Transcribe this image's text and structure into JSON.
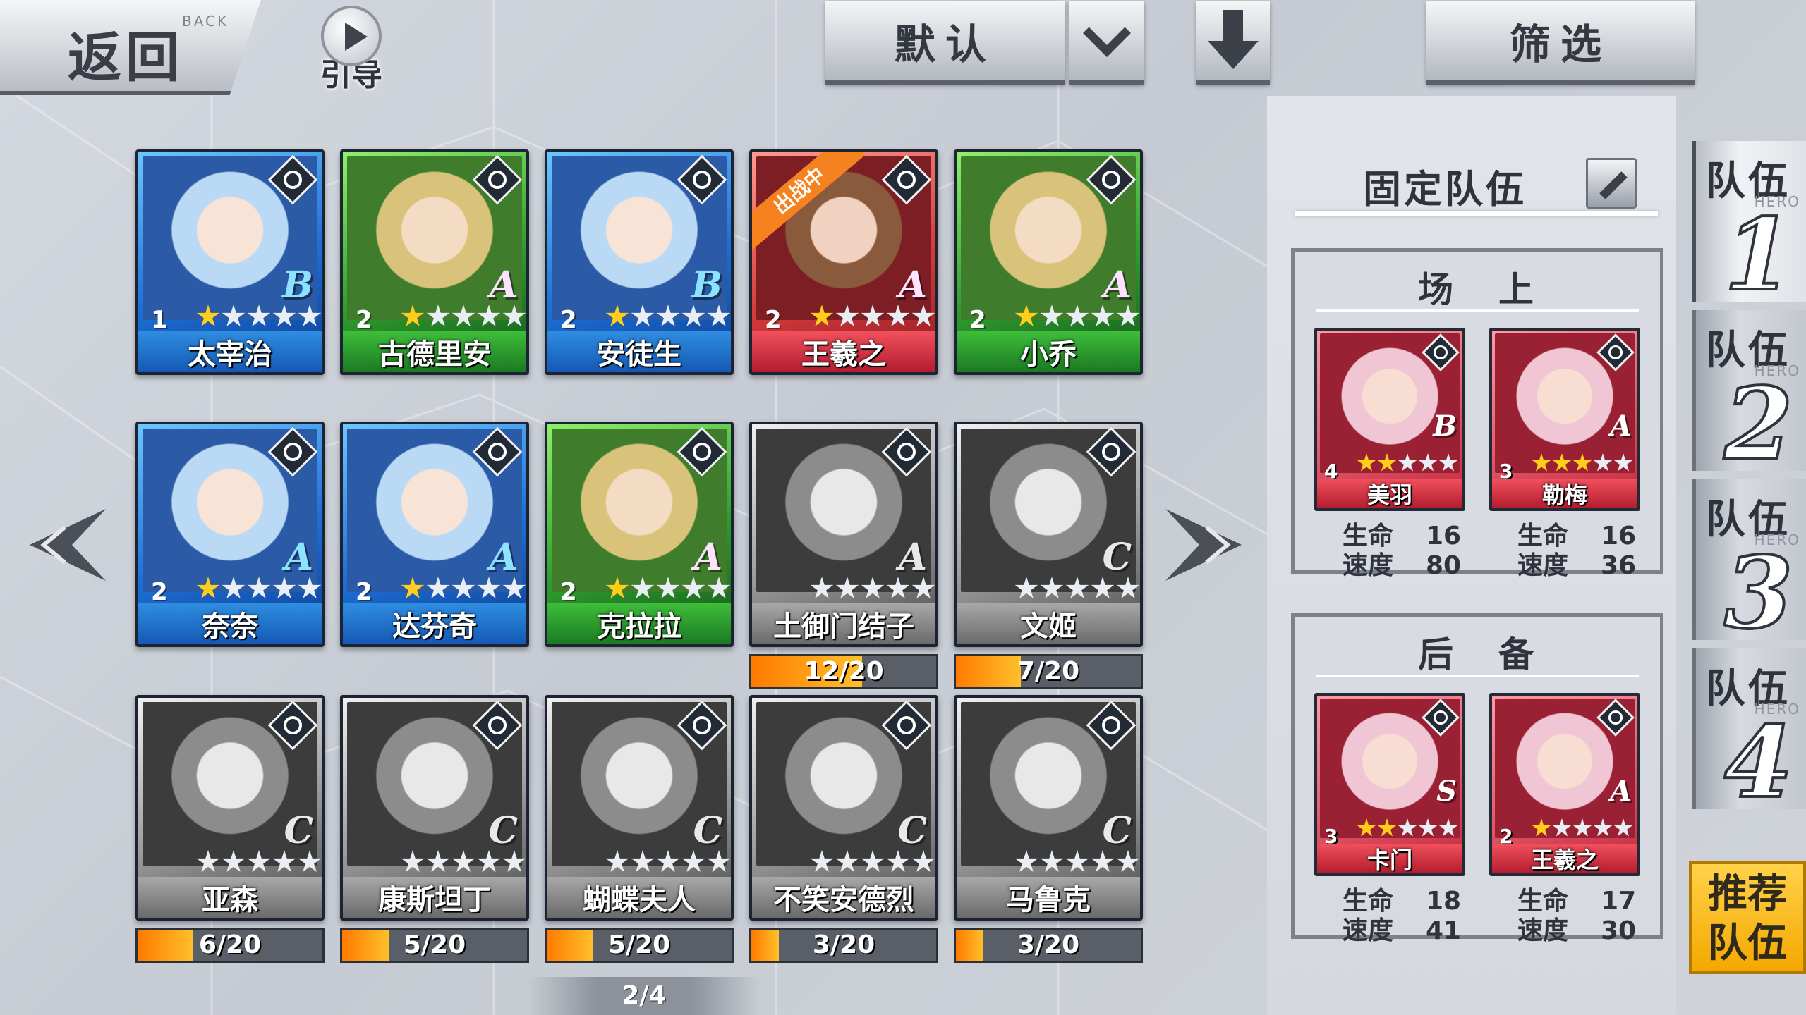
{
  "header": {
    "back_label": "返回",
    "back_sub": "BACK",
    "guide_label": "引导",
    "sort_label": "默认",
    "filter_label": "筛选"
  },
  "heroes": [
    {
      "name": "太宰治",
      "level": "1",
      "rank": "B",
      "stars": 1,
      "color": "blue",
      "class_icon": "cross-icon"
    },
    {
      "name": "古德里安",
      "level": "2",
      "rank": "A",
      "stars": 1,
      "color": "green",
      "class_icon": "crosshair-icon"
    },
    {
      "name": "安徒生",
      "level": "2",
      "rank": "B",
      "stars": 1,
      "color": "blue",
      "class_icon": "mask-icon"
    },
    {
      "name": "王羲之",
      "level": "2",
      "rank": "A",
      "stars": 1,
      "color": "red",
      "class_icon": "fist-icon",
      "badge": "出战中"
    },
    {
      "name": "小乔",
      "level": "2",
      "rank": "A",
      "stars": 1,
      "color": "green",
      "class_icon": "hammer-icon"
    },
    {
      "name": "奈奈",
      "level": "2",
      "rank": "A",
      "stars": 1,
      "color": "blue",
      "class_icon": "witch-hat-icon"
    },
    {
      "name": "达芬奇",
      "level": "2",
      "rank": "A",
      "stars": 1,
      "color": "blue",
      "class_icon": "flask-icon"
    },
    {
      "name": "克拉拉",
      "level": "2",
      "rank": "A",
      "stars": 1,
      "color": "green",
      "class_icon": "fan-icon"
    },
    {
      "name": "土御门结子",
      "level": "",
      "rank": "A",
      "stars": 0,
      "color": "gray",
      "class_icon": "bow-icon",
      "fragments": "12/20",
      "progress": 0.6
    },
    {
      "name": "文姬",
      "level": "",
      "rank": "C",
      "stars": 0,
      "color": "gray",
      "class_icon": "fan-icon",
      "fragments": "7/20",
      "progress": 0.35
    },
    {
      "name": "亚森",
      "level": "",
      "rank": "C",
      "stars": 0,
      "color": "gray",
      "class_icon": "shuriken-icon",
      "fragments": "6/20",
      "progress": 0.3
    },
    {
      "name": "康斯坦丁",
      "level": "",
      "rank": "C",
      "stars": 0,
      "color": "gray",
      "class_icon": "fist-icon",
      "fragments": "5/20",
      "progress": 0.25
    },
    {
      "name": "蝴蝶夫人",
      "level": "",
      "rank": "C",
      "stars": 0,
      "color": "gray",
      "class_icon": "fan-icon",
      "fragments": "5/20",
      "progress": 0.25
    },
    {
      "name": "不笑安德烈",
      "level": "",
      "rank": "C",
      "stars": 0,
      "color": "gray",
      "class_icon": "crosshair-icon",
      "fragments": "3/20",
      "progress": 0.15
    },
    {
      "name": "马鲁克",
      "level": "",
      "rank": "C",
      "stars": 0,
      "color": "gray",
      "class_icon": "lightning-icon",
      "fragments": "3/20",
      "progress": 0.15
    }
  ],
  "pager": "2/4",
  "team_panel": {
    "title": "固定队伍",
    "field_label": "场上",
    "reserve_label": "后备",
    "hp_label": "生命",
    "speed_label": "速度",
    "field": [
      {
        "name": "美羽",
        "level": "4",
        "rank": "B",
        "stars": 2,
        "hp": "16",
        "speed": "80"
      },
      {
        "name": "勒梅",
        "level": "3",
        "rank": "A",
        "stars": 3,
        "hp": "16",
        "speed": "36"
      }
    ],
    "reserve": [
      {
        "name": "卡门",
        "level": "3",
        "rank": "S",
        "stars": 2,
        "hp": "18",
        "speed": "41"
      },
      {
        "name": "王羲之",
        "level": "2",
        "rank": "A",
        "stars": 1,
        "hp": "17",
        "speed": "30"
      }
    ]
  },
  "team_tabs": [
    {
      "label": "队伍",
      "num": "1",
      "hero": "HERO"
    },
    {
      "label": "队伍",
      "num": "2",
      "hero": "HERO"
    },
    {
      "label": "队伍",
      "num": "3",
      "hero": "HERO"
    },
    {
      "label": "队伍",
      "num": "4",
      "hero": "HERO"
    }
  ],
  "recommend_label_1": "推荐",
  "recommend_label_2": "队伍"
}
